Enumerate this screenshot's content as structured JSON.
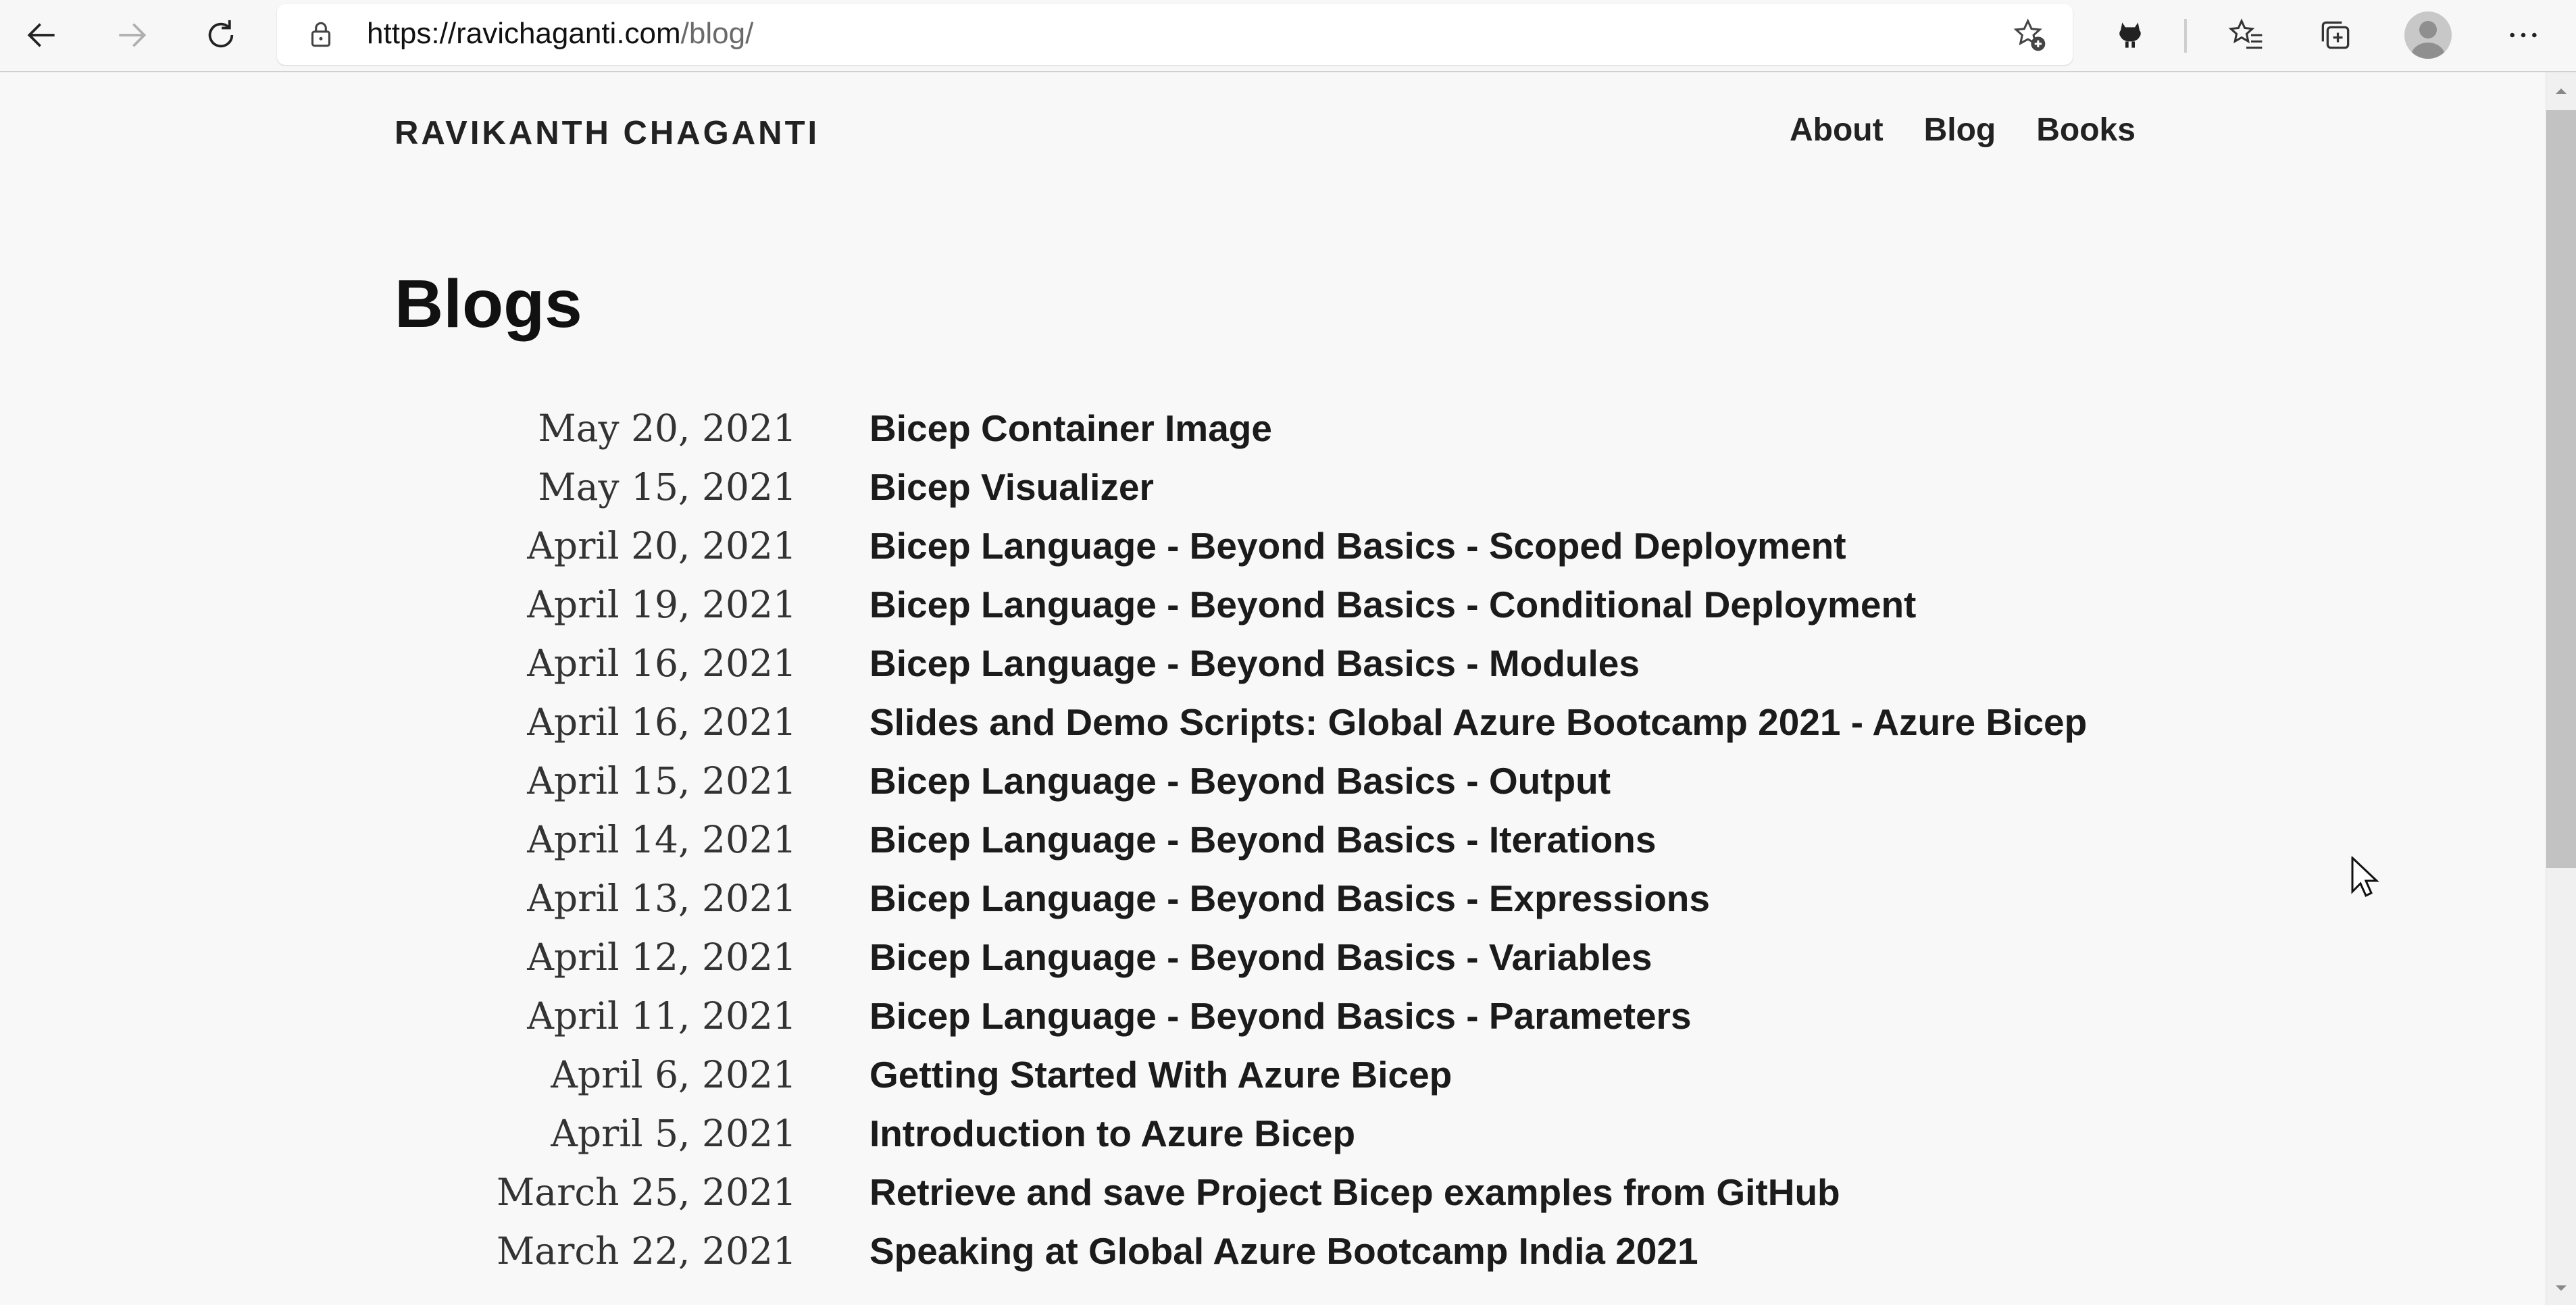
{
  "browser": {
    "url_host": "https://ravichaganti.com",
    "url_path": "/blog/"
  },
  "site": {
    "title": "RAVIKANTH CHAGANTI",
    "nav": [
      "About",
      "Blog",
      "Books"
    ]
  },
  "page_title": "Blogs",
  "posts": [
    {
      "date": "May 20, 2021",
      "title": "Bicep Container Image"
    },
    {
      "date": "May 15, 2021",
      "title": "Bicep Visualizer"
    },
    {
      "date": "April 20, 2021",
      "title": "Bicep Language - Beyond Basics - Scoped Deployment"
    },
    {
      "date": "April 19, 2021",
      "title": "Bicep Language - Beyond Basics - Conditional Deployment"
    },
    {
      "date": "April 16, 2021",
      "title": "Bicep Language - Beyond Basics - Modules"
    },
    {
      "date": "April 16, 2021",
      "title": "Slides and Demo Scripts: Global Azure Bootcamp 2021 - Azure Bicep"
    },
    {
      "date": "April 15, 2021",
      "title": "Bicep Language - Beyond Basics - Output"
    },
    {
      "date": "April 14, 2021",
      "title": "Bicep Language - Beyond Basics - Iterations"
    },
    {
      "date": "April 13, 2021",
      "title": "Bicep Language - Beyond Basics - Expressions"
    },
    {
      "date": "April 12, 2021",
      "title": "Bicep Language - Beyond Basics - Variables"
    },
    {
      "date": "April 11, 2021",
      "title": "Bicep Language - Beyond Basics - Parameters"
    },
    {
      "date": "April 6, 2021",
      "title": "Getting Started With Azure Bicep"
    },
    {
      "date": "April 5, 2021",
      "title": "Introduction to Azure Bicep"
    },
    {
      "date": "March 25, 2021",
      "title": "Retrieve and save Project Bicep examples from GitHub"
    },
    {
      "date": "March 22, 2021",
      "title": "Speaking at Global Azure Bootcamp India 2021"
    }
  ],
  "icons": {
    "back": "arrow-left-icon",
    "forward": "arrow-right-icon",
    "refresh": "refresh-icon",
    "lock": "lock-icon",
    "add_favorite": "star-plus-icon",
    "extension": "github-extension-icon",
    "favorites": "favorites-list-icon",
    "collections": "collections-icon",
    "profile": "profile-avatar-icon",
    "menu": "more-icon"
  }
}
